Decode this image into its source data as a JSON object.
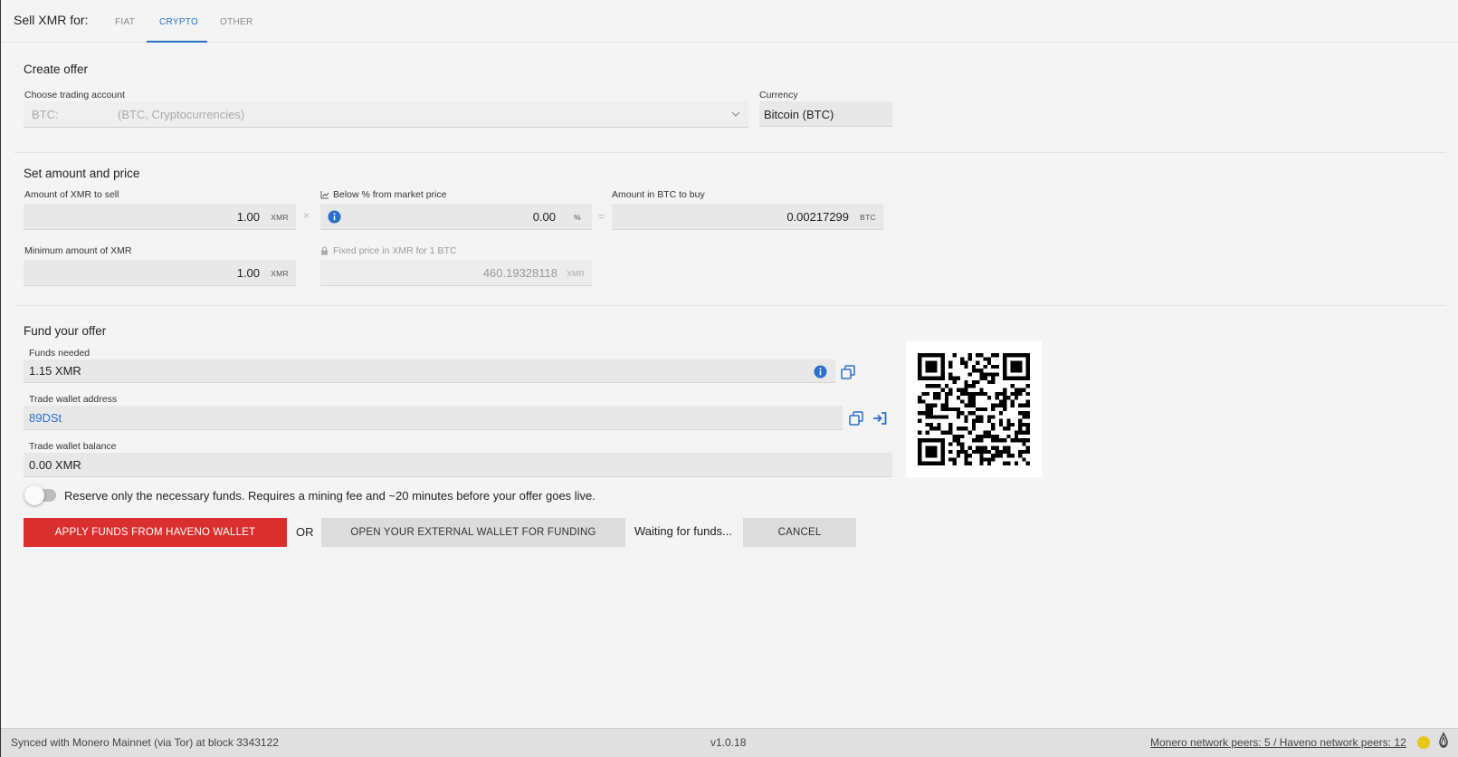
{
  "header": {
    "title": "Sell XMR for:",
    "tabs": [
      {
        "label": "FIAT",
        "active": false
      },
      {
        "label": "CRYPTO",
        "active": true
      },
      {
        "label": "OTHER",
        "active": false
      }
    ]
  },
  "create_offer": {
    "title": "Create offer",
    "account_label": "Choose trading account",
    "account_value_code": "BTC:",
    "account_value_desc": "(BTC, Cryptocurrencies)",
    "currency_label": "Currency",
    "currency_value": "Bitcoin (BTC)"
  },
  "amount_price": {
    "title": "Set amount and price",
    "amount_label": "Amount of XMR to sell",
    "amount_value": "1.00",
    "amount_unit": "XMR",
    "multiply": "×",
    "below_label": "Below % from market price",
    "below_value": "0.00",
    "below_unit": "%",
    "equals": "=",
    "btc_label": "Amount in BTC to buy",
    "btc_value": "0.00217299",
    "btc_unit": "BTC",
    "min_label": "Minimum amount of XMR",
    "min_value": "1.00",
    "min_unit": "XMR",
    "fixed_label": "Fixed price in XMR for 1 BTC",
    "fixed_value": "460.19328118",
    "fixed_unit": "XMR"
  },
  "fund": {
    "title": "Fund your offer",
    "funds_needed_label": "Funds needed",
    "funds_needed_value": "1.15 XMR",
    "address_label": "Trade wallet address",
    "address_value": "89DSt",
    "balance_label": "Trade wallet balance",
    "balance_value": "0.00 XMR",
    "reserve_text": "Reserve only the necessary funds. Requires a mining fee and ~20 minutes before your offer goes live.",
    "apply_button": "APPLY FUNDS FROM HAVENO WALLET",
    "or_text": "OR",
    "external_button": "OPEN YOUR EXTERNAL WALLET FOR FUNDING",
    "waiting_text": "Waiting for funds...",
    "cancel_button": "CANCEL"
  },
  "status": {
    "sync_text": "Synced with Monero Mainnet (via Tor) at block 3343122",
    "version": "v1.0.18",
    "peers_text": "Monero network peers: 5 / Haveno network peers: 12"
  },
  "colors": {
    "accent": "#2a6fc9",
    "primary_button": "#d92f2f",
    "status_dot": "#e6c619"
  },
  "icons": [
    "info-icon",
    "copy-icon",
    "open-wallet-icon",
    "chart-icon",
    "lock-icon",
    "chevron-down-icon",
    "qr-code",
    "tor-icon"
  ]
}
